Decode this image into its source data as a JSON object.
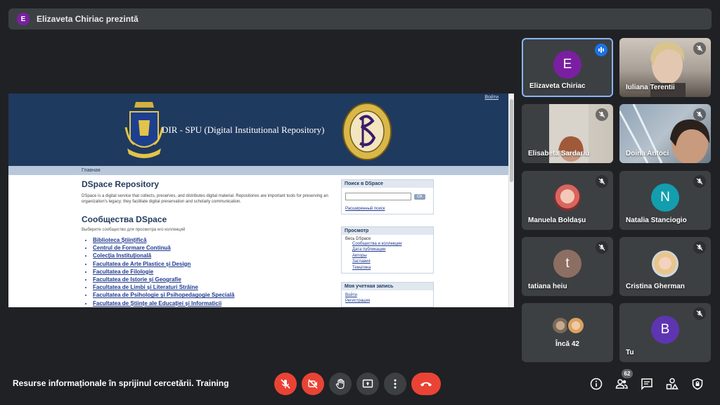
{
  "presenter": {
    "initial": "E",
    "text": "Elizaveta Chiriac prezintă",
    "avatar_color": "#7b1fa2"
  },
  "shared_screen": {
    "header": {
      "login_link": "Войти",
      "title": "DIR - SPU (Digital Institutional Repository)"
    },
    "breadcrumb": "Главная",
    "main": {
      "heading": "DSpace Repository",
      "intro": "DSpace is a digital service that collects, preserves, and distributes digital material. Repositories are important tools for preserving an organization's legacy; they facilitate digital preservation and scholarly communication.",
      "communities_heading": "Сообщества DSpace",
      "communities_sub": "Выберите сообщество для просмотра его коллекций",
      "communities": [
        "Biblioteca Științifică",
        "Centrul de Formare Continuă",
        "Colecția Instituțională",
        "Facultatea de Arte Plastice și Design",
        "Facultatea de Filologie",
        "Facultatea de Istorie și Geografie",
        "Facultatea de Limbi și Literaturi Străine",
        "Facultatea de Psihologie și Psihopedagogie Specială",
        "Facultatea de Științe ale Educației și Informaticii"
      ]
    },
    "sidebar": {
      "search_title": "Поиск в DSpace",
      "search_button": "Ok",
      "advanced_search": "Расширенный поиск",
      "browse_title": "Просмотр",
      "browse_all": "Весь DSpace",
      "browse_links": [
        "Сообщества и коллекции",
        "Дата публикации",
        "Авторы",
        "Заглавия",
        "Тематика"
      ],
      "account_title": "Моя учетная запись",
      "account_links": [
        "Войти",
        "Регистрация"
      ]
    }
  },
  "participants": [
    {
      "name": "Elizaveta Chiriac",
      "initial": "E",
      "avatar_color": "#7b1fa2",
      "state": "speaking",
      "active": true
    },
    {
      "name": "Iuliana Terentii",
      "state": "muted",
      "video": true
    },
    {
      "name": "Elisabeta Sardariu",
      "state": "muted",
      "video": true
    },
    {
      "name": "Doina Antoci",
      "state": "muted",
      "video": true
    },
    {
      "name": "Manuela Boldașu",
      "state": "muted",
      "photo": true
    },
    {
      "name": "Natalia Stanciogio",
      "initial": "N",
      "avatar_color": "#129eaf",
      "state": "muted"
    },
    {
      "name": "tatiana heiu",
      "initial": "t",
      "avatar_color": "#8d6e63",
      "state": "muted"
    },
    {
      "name": "Cristina Gherman",
      "state": "muted",
      "photo": true
    },
    {
      "name": "Tu",
      "initial": "B",
      "avatar_color": "#5e35b1",
      "state": "muted"
    }
  ],
  "more_participants": "Încă 42",
  "meeting": {
    "title": "Resurse informaționale în sprijinul cercetării. Training",
    "participant_count": "62"
  },
  "controls": [
    "mic-off",
    "camera-off",
    "raise-hand",
    "present",
    "more-options",
    "leave-call"
  ],
  "right_controls": [
    "info",
    "people",
    "chat",
    "activities",
    "host-controls"
  ]
}
